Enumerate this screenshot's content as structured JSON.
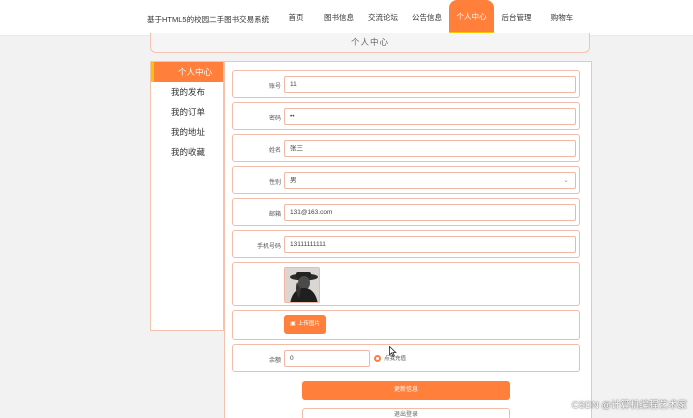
{
  "header": {
    "site_title": "基于HTML5的校园二手图书交易系统",
    "nav": [
      {
        "label": "首页",
        "active": false
      },
      {
        "label": "图书信息",
        "active": false
      },
      {
        "label": "交流论坛",
        "active": false
      },
      {
        "label": "公告信息",
        "active": false
      },
      {
        "label": "个人中心",
        "active": true
      },
      {
        "label": "后台管理",
        "active": false
      },
      {
        "label": "购物车",
        "active": false
      }
    ]
  },
  "page_title": "个人中心",
  "sidebar": {
    "items": [
      {
        "label": "个人中心",
        "active": true
      },
      {
        "label": "我的发布",
        "active": false
      },
      {
        "label": "我的订单",
        "active": false
      },
      {
        "label": "我的地址",
        "active": false
      },
      {
        "label": "我的收藏",
        "active": false
      }
    ]
  },
  "form": {
    "account": {
      "label": "账号",
      "value": "11"
    },
    "password": {
      "label": "密码",
      "value": "••"
    },
    "name": {
      "label": "姓名",
      "value": "张三"
    },
    "gender": {
      "label": "性别",
      "value": "男"
    },
    "email": {
      "label": "邮箱",
      "value": "131@163.com"
    },
    "phone": {
      "label": "手机号码",
      "value": "13111111111"
    },
    "upload_label": "上传图片",
    "balance": {
      "label": "余额",
      "value": "0",
      "recharge_label": "点我充值"
    },
    "update_label": "更新信息",
    "logout_label": "退出登录"
  },
  "watermark": "CSDN @计算机编程艺术家",
  "colors": {
    "accent": "#ff7f3b",
    "accent_border": "#f7c400",
    "field_border": "#f0b7a4"
  }
}
